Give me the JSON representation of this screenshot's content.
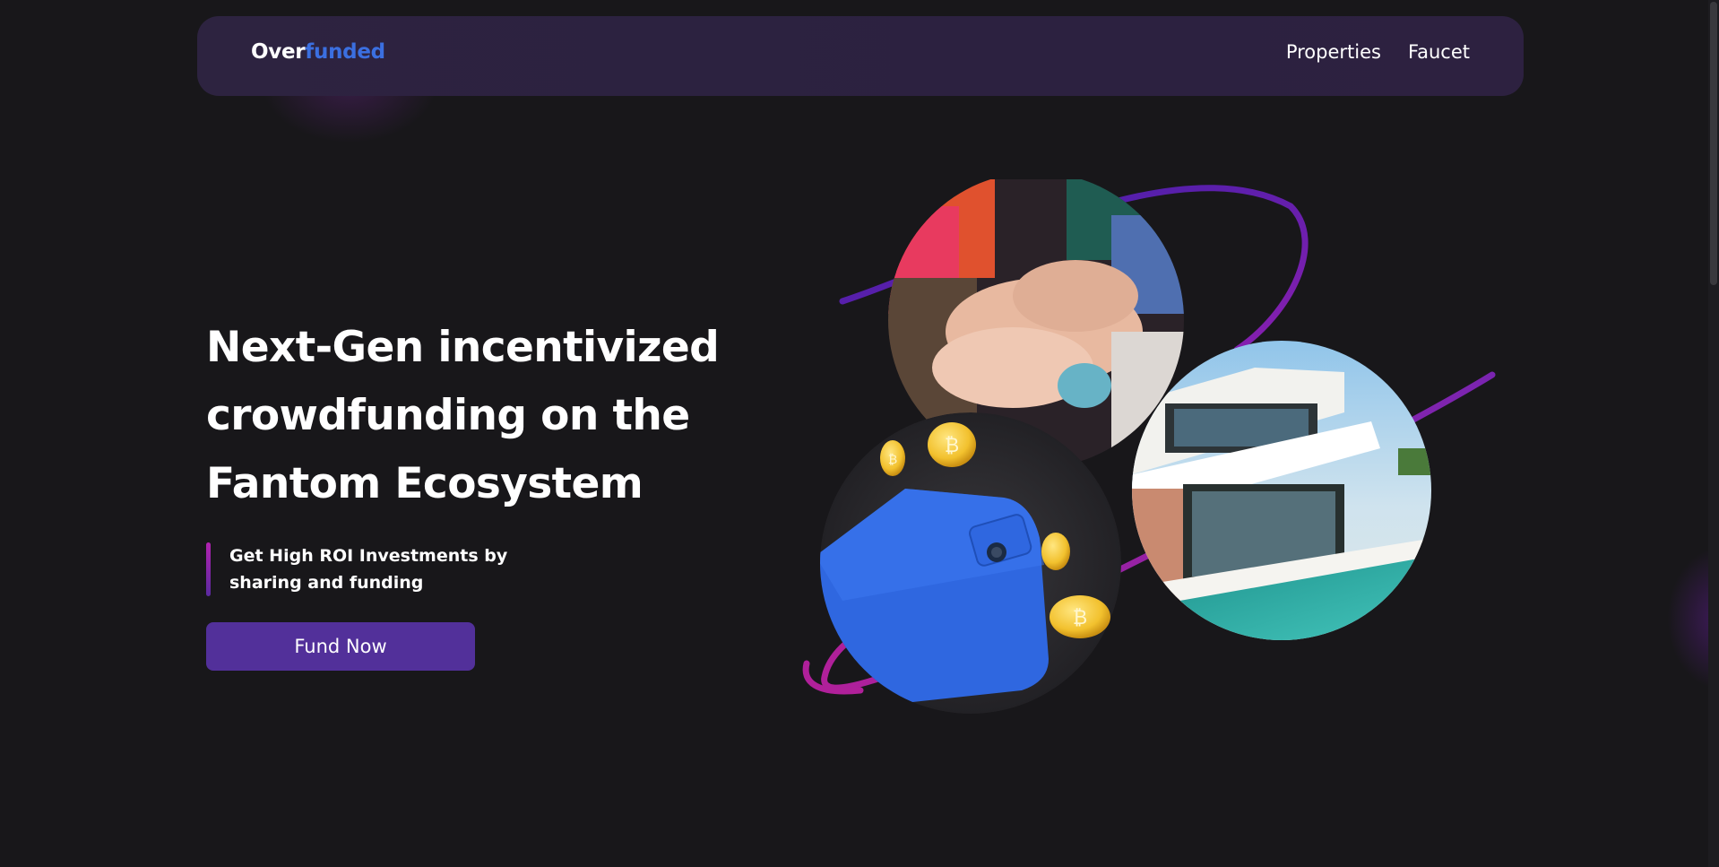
{
  "brand": {
    "logo_part1": "Over",
    "logo_part2": "funded",
    "accent_color": "#3b6fe0",
    "primary_color": "#52309a"
  },
  "nav": {
    "links": [
      {
        "label": "Properties"
      },
      {
        "label": "Faucet"
      }
    ]
  },
  "hero": {
    "title": "Next-Gen incentivized crowdfunding on the Fantom Ecosystem",
    "subtitle": "Get High ROI Investments by sharing and funding",
    "cta_label": "Fund Now"
  },
  "illustration": {
    "images": [
      "team-hands-photo",
      "wallet-with-coins-render",
      "modern-house-photo"
    ]
  }
}
